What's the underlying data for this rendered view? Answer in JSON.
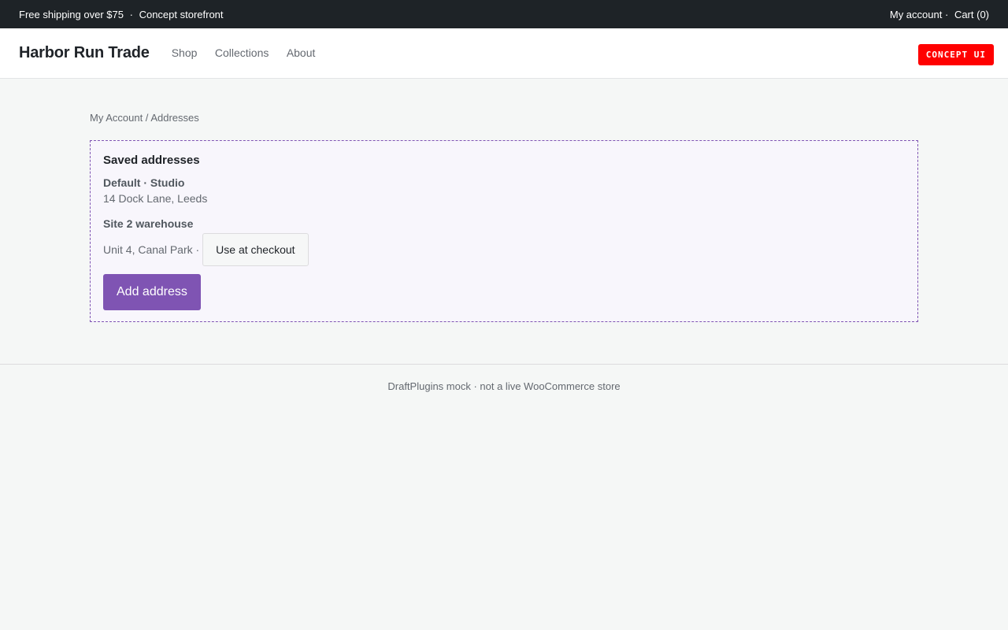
{
  "topbar": {
    "promo": "Free shipping over $75",
    "promo_sep": "·",
    "promo_suffix": "Concept storefront",
    "account": "My account",
    "sep": "·",
    "cart": "Cart (0)"
  },
  "header": {
    "brand": "Harbor Run Trade",
    "nav": [
      "Shop",
      "Collections",
      "About"
    ],
    "badge": "CONCEPT UI"
  },
  "breadcrumb": "My Account / Addresses",
  "addresses": {
    "title": "Saved addresses",
    "items": [
      {
        "label": "Default · Studio",
        "line": "14 Dock Lane, Leeds"
      },
      {
        "label": "Site 2 warehouse",
        "line": "Unit 4, Canal Park ·",
        "action": "Use at checkout"
      }
    ],
    "add_label": "Add address"
  },
  "footer": {
    "text": "DraftPlugins mock · not a live WooCommerce store"
  },
  "colors": {
    "topbar_bg": "#1e2327",
    "accent": "#7f54b3",
    "badge": "#ff0000"
  }
}
